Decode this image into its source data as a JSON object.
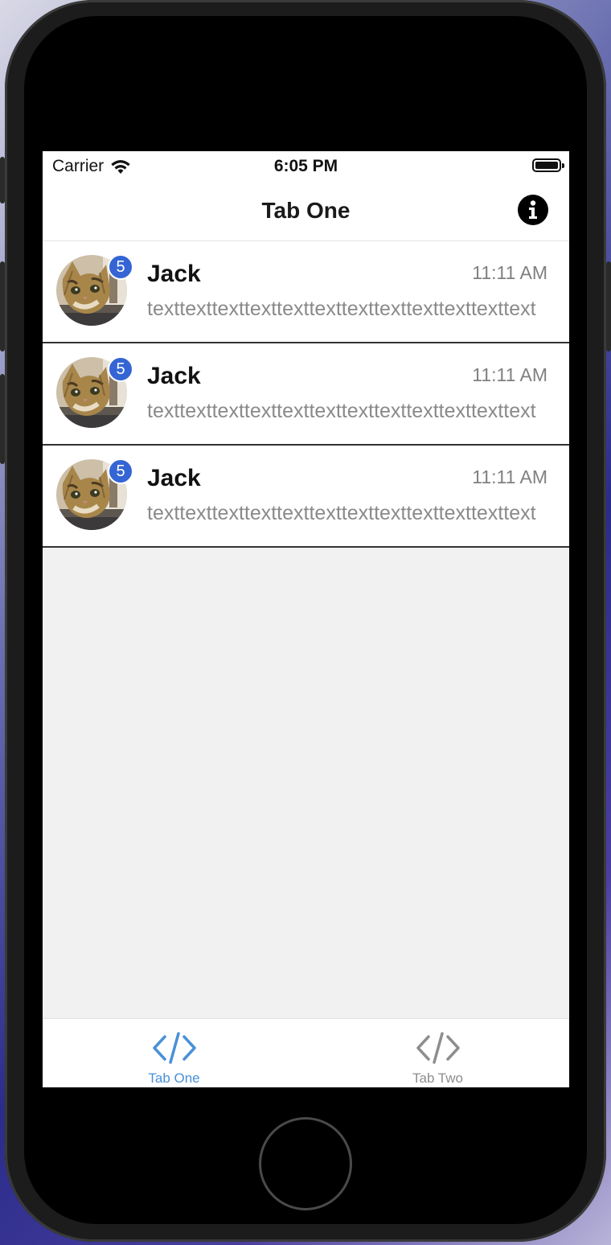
{
  "status_bar": {
    "carrier": "Carrier",
    "time": "6:05 PM",
    "wifi_icon": "wifi-icon",
    "battery_icon": "battery-icon"
  },
  "nav": {
    "title": "Tab One",
    "info_icon": "info-icon"
  },
  "conversations": [
    {
      "name": "Jack",
      "time": "11:11 AM",
      "preview": "texttexttexttexttexttexttexttexttexttexttexttext",
      "badge": "5"
    },
    {
      "name": "Jack",
      "time": "11:11 AM",
      "preview": "texttexttexttexttexttexttexttexttexttexttexttext",
      "badge": "5"
    },
    {
      "name": "Jack",
      "time": "11:11 AM",
      "preview": "texttexttexttexttexttexttexttexttexttexttexttext",
      "badge": "5"
    }
  ],
  "tabs": [
    {
      "label": "Tab One",
      "icon": "code-icon",
      "active": true
    },
    {
      "label": "Tab Two",
      "icon": "code-icon",
      "active": false
    }
  ],
  "colors": {
    "accent": "#4a90d9",
    "badge": "#3565d4",
    "inactive_tab": "#8e8e8e"
  }
}
